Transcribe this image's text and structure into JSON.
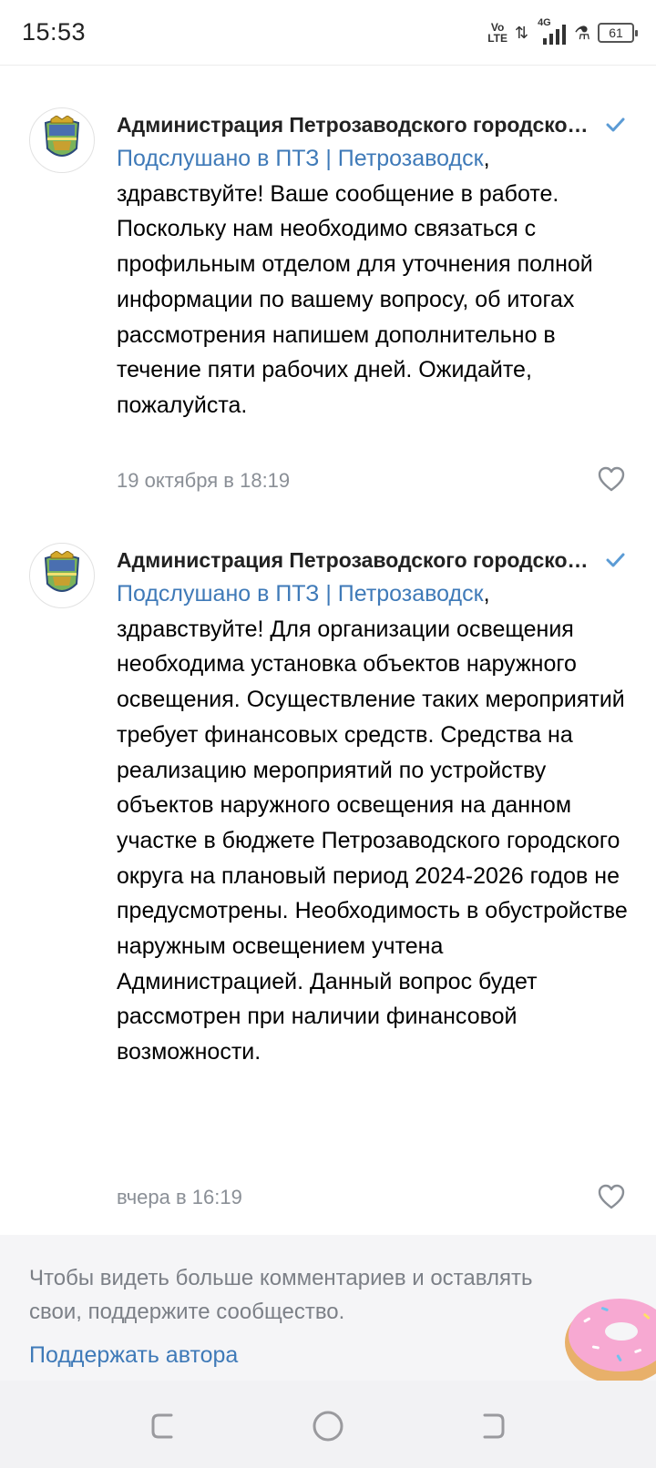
{
  "status_bar": {
    "time": "15:53",
    "volte_top": "Vo",
    "volte_bottom": "LTE",
    "network": "4G",
    "battery": "61"
  },
  "comments": [
    {
      "author": "Администрация Петрозаводского городского округа",
      "mention": "Подслушано в ПТЗ | Петрозаводск",
      "text": ", здравствуйте! Ваше сообщение в работе. Поскольку нам необходимо связаться с профильным отделом для уточнения полной информации по вашему вопросу, об итогах рассмотрения напишем дополнительно в течение пяти рабочих дней. Ожидайте, пожалуйста.",
      "time": "19 октября в 18:19",
      "verified_icon": "verified-check-icon",
      "like_icon": "heart-outline-icon"
    },
    {
      "author": "Администрация Петрозаводского городского округа",
      "mention": "Подслушано в ПТЗ | Петрозаводск",
      "text": ", здравствуйте! Для организации освещения необходима установка объектов наружного освещения. Осуществление таких мероприятий требует финансовых средств. Средства на реализацию мероприятий по устройству объектов наружного освещения на данном участке в бюджете Петрозаводского городского округа на плановый период 2024-2026 годов не предусмотрены. Необходимость в обустройстве наружным освещением учтена Администрацией. Данный вопрос будет рассмотрен при наличии финансовой возможности.",
      "time": "вчера в 16:19",
      "verified_icon": "verified-check-icon",
      "like_icon": "heart-outline-icon"
    }
  ],
  "donut": {
    "text": "Чтобы видеть больше комментариев и оставлять свои, поддержите сообщество.",
    "link": "Поддержать автора",
    "image_icon": "donut-icon"
  },
  "nav_bar": {
    "recents_icon": "recents-icon",
    "home_icon": "home-icon",
    "back_icon": "back-icon"
  },
  "colors": {
    "link": "#3f7ab8",
    "verified": "#5b9bd5",
    "meta": "#8a8f96"
  }
}
